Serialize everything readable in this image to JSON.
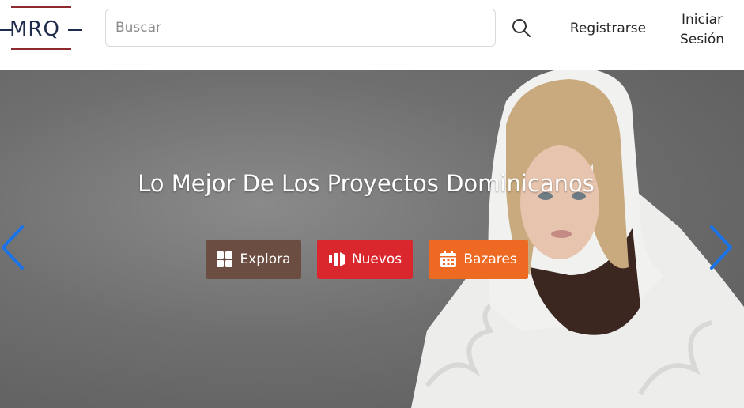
{
  "header": {
    "logo_text": "MRQ",
    "search_placeholder": "Buscar",
    "register_label": "Registrarse",
    "login_line1": "Iniciar",
    "login_line2": "Sesión"
  },
  "hero": {
    "title": "Lo Mejor De Los Proyectos Dominicanos",
    "buttons": [
      {
        "label": "Explora",
        "icon": "grid-icon",
        "color": "#6b4d41"
      },
      {
        "label": "Nuevos",
        "icon": "bars-icon",
        "color": "#d9272d"
      },
      {
        "label": "Bazares",
        "icon": "calendar-icon",
        "color": "#ee6a22"
      }
    ],
    "arrow_color": "#1a73e8"
  }
}
